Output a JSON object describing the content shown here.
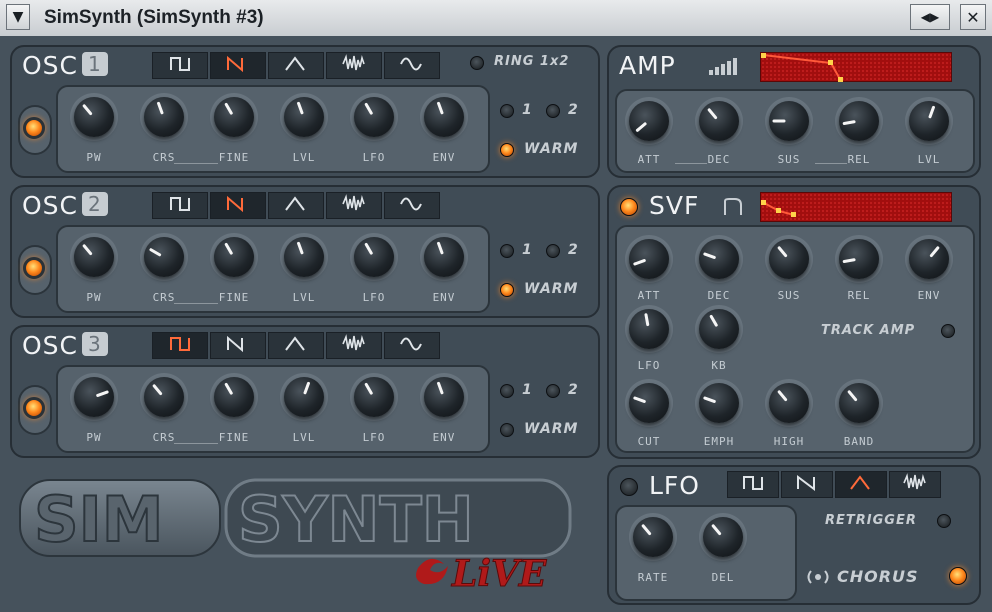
{
  "window": {
    "title": "SimSynth (SimSynth #3)"
  },
  "osc": [
    {
      "title": "OSC",
      "number": "1",
      "knobs": [
        "PW",
        "CRS",
        "FINE",
        "LVL",
        "LFO",
        "ENV"
      ],
      "angles": [
        -40,
        -20,
        -30,
        -20,
        -30,
        -20
      ],
      "selected_wave": 1,
      "enabled": true,
      "warm": true
    },
    {
      "title": "OSC",
      "number": "2",
      "knobs": [
        "PW",
        "CRS",
        "FINE",
        "LVL",
        "LFO",
        "ENV"
      ],
      "angles": [
        -40,
        -60,
        -30,
        -20,
        -30,
        -20
      ],
      "selected_wave": 1,
      "enabled": true,
      "warm": true
    },
    {
      "title": "OSC",
      "number": "3",
      "knobs": [
        "PW",
        "CRS",
        "FINE",
        "LVL",
        "LFO",
        "ENV"
      ],
      "angles": [
        70,
        -40,
        -30,
        20,
        -30,
        -20
      ],
      "selected_wave": 0,
      "enabled": true,
      "warm": false
    }
  ],
  "osc_options": {
    "ring_label": "RING 1x2",
    "opt1": "1",
    "opt2": "2",
    "warm_label": "WARM"
  },
  "amp": {
    "title": "AMP",
    "knobs": [
      "ATT",
      "DEC",
      "SUS",
      "REL",
      "LVL"
    ],
    "angles": [
      -130,
      -40,
      -90,
      -100,
      20
    ]
  },
  "svf": {
    "title": "SVF",
    "knobs_row1": [
      "ATT",
      "DEC",
      "SUS",
      "REL",
      "ENV"
    ],
    "row1_angles": [
      -110,
      -70,
      -40,
      -100,
      40
    ],
    "knobs_row2": [
      "LFO",
      "KB"
    ],
    "row2_angles": [
      -10,
      -30
    ],
    "knobs_row3": [
      "CUT",
      "EMPH",
      "HIGH",
      "BAND"
    ],
    "row3_angles": [
      -70,
      -70,
      -40,
      -40
    ],
    "track_amp_label": "TRACK AMP",
    "enabled": true
  },
  "lfo": {
    "title": "LFO",
    "knobs": [
      "RATE",
      "DEL"
    ],
    "angles": [
      -40,
      -40
    ],
    "retrigger_label": "RETRIGGER",
    "selected_wave": 2,
    "enabled": false
  },
  "chorus": {
    "label": "CHORUS",
    "enabled": true
  },
  "logo": {
    "sim": "SIM",
    "synth": "SYNTH",
    "live": "LiVE"
  },
  "colors": {
    "led_on": "#ff8a1e",
    "envelope_bg": "#a10e0e",
    "accent_wave": "#ff6a3a"
  }
}
